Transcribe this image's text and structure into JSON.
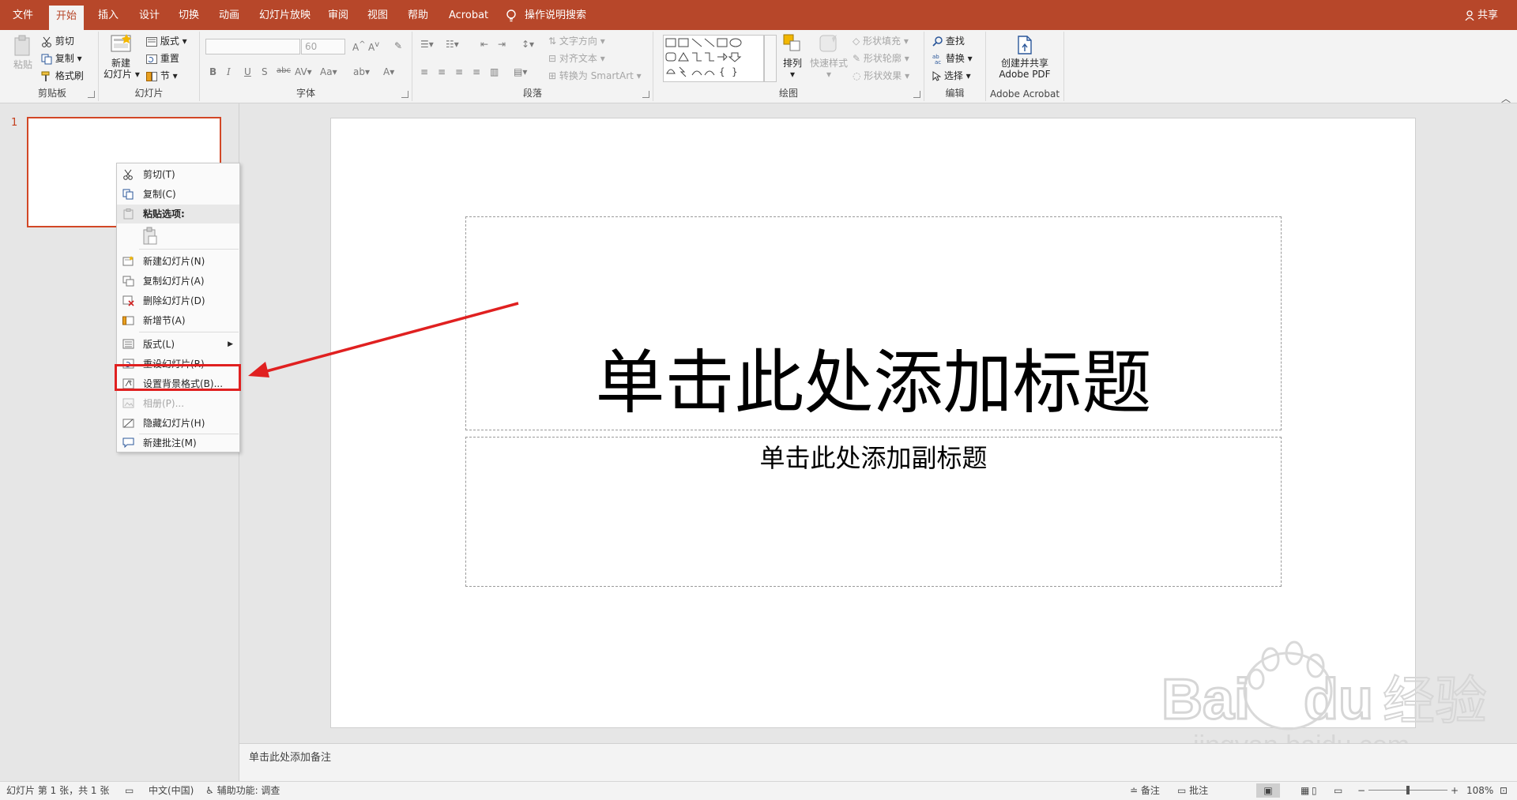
{
  "tabs": [
    {
      "label": "文件"
    },
    {
      "label": "开始"
    },
    {
      "label": "插入"
    },
    {
      "label": "设计"
    },
    {
      "label": "切换"
    },
    {
      "label": "动画"
    },
    {
      "label": "幻灯片放映"
    },
    {
      "label": "审阅"
    },
    {
      "label": "视图"
    },
    {
      "label": "帮助"
    },
    {
      "label": "Acrobat"
    }
  ],
  "tell_me": "操作说明搜索",
  "share": "共享",
  "ribbon": {
    "clipboard": {
      "paste": "粘贴",
      "cut": "剪切",
      "copy": "复制",
      "format_painter": "格式刷",
      "label": "剪贴板"
    },
    "slides": {
      "new_slide_line1": "新建",
      "new_slide_line2": "幻灯片",
      "layout": "版式",
      "reset": "重置",
      "section": "节",
      "label": "幻灯片"
    },
    "font": {
      "size": "60",
      "label": "字体"
    },
    "paragraph": {
      "text_direction": "文字方向",
      "align_text": "对齐文本",
      "smartart": "转换为 SmartArt",
      "label": "段落"
    },
    "drawing": {
      "arrange": "排列",
      "quick_styles": "快速样式",
      "shape_fill": "形状填充",
      "shape_outline": "形状轮廓",
      "shape_effects": "形状效果",
      "label": "绘图"
    },
    "editing": {
      "find": "查找",
      "replace": "替换",
      "select": "选择",
      "label": "编辑"
    },
    "acrobat": {
      "create_line1": "创建并共享",
      "create_line2": "Adobe PDF",
      "label": "Adobe Acrobat"
    }
  },
  "slide_number": "1",
  "context_menu": {
    "cut": "剪切(T)",
    "copy": "复制(C)",
    "paste_options": "粘贴选项:",
    "new_slide": "新建幻灯片(N)",
    "duplicate_slide": "复制幻灯片(A)",
    "delete_slide": "删除幻灯片(D)",
    "add_section": "新增节(A)",
    "layout": "版式(L)",
    "reset_slide": "重设幻灯片(R)",
    "format_background": "设置背景格式(B)...",
    "photo_album": "相册(P)...",
    "hide_slide": "隐藏幻灯片(H)",
    "new_comment": "新建批注(M)"
  },
  "slide": {
    "title_placeholder": "单击此处添加标题",
    "subtitle_placeholder": "单击此处添加副标题"
  },
  "notes_placeholder": "单击此处添加备注",
  "status": {
    "slide_info": "幻灯片 第 1 张，共 1 张",
    "language": "中文(中国)",
    "accessibility": "辅助功能: 调查",
    "notes": "备注",
    "comments": "批注",
    "zoom": "108%"
  },
  "colors": {
    "accent": "#b7472a",
    "highlight": "#e02020"
  },
  "icons": [
    "lightbulb-icon",
    "person-icon",
    "paste-icon",
    "scissors-icon",
    "copy-icon",
    "brush-icon",
    "new-slide-icon",
    "layout-icon",
    "reset-icon",
    "section-icon",
    "search-icon",
    "replace-icon",
    "cursor-icon",
    "pdf-icon"
  ]
}
